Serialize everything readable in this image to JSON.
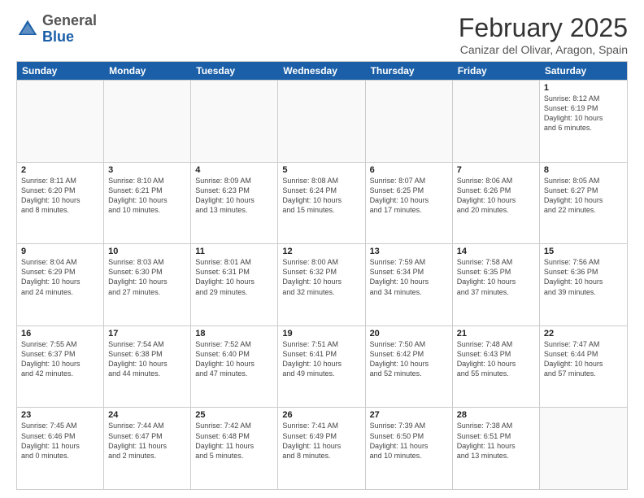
{
  "header": {
    "logo_general": "General",
    "logo_blue": "Blue",
    "month_title": "February 2025",
    "location": "Canizar del Olivar, Aragon, Spain"
  },
  "days_of_week": [
    "Sunday",
    "Monday",
    "Tuesday",
    "Wednesday",
    "Thursday",
    "Friday",
    "Saturday"
  ],
  "weeks": [
    [
      {
        "day": "",
        "empty": true
      },
      {
        "day": "",
        "empty": true
      },
      {
        "day": "",
        "empty": true
      },
      {
        "day": "",
        "empty": true
      },
      {
        "day": "",
        "empty": true
      },
      {
        "day": "",
        "empty": true
      },
      {
        "day": "1",
        "info": "Sunrise: 8:12 AM\nSunset: 6:19 PM\nDaylight: 10 hours\nand 6 minutes."
      }
    ],
    [
      {
        "day": "2",
        "info": "Sunrise: 8:11 AM\nSunset: 6:20 PM\nDaylight: 10 hours\nand 8 minutes."
      },
      {
        "day": "3",
        "info": "Sunrise: 8:10 AM\nSunset: 6:21 PM\nDaylight: 10 hours\nand 10 minutes."
      },
      {
        "day": "4",
        "info": "Sunrise: 8:09 AM\nSunset: 6:23 PM\nDaylight: 10 hours\nand 13 minutes."
      },
      {
        "day": "5",
        "info": "Sunrise: 8:08 AM\nSunset: 6:24 PM\nDaylight: 10 hours\nand 15 minutes."
      },
      {
        "day": "6",
        "info": "Sunrise: 8:07 AM\nSunset: 6:25 PM\nDaylight: 10 hours\nand 17 minutes."
      },
      {
        "day": "7",
        "info": "Sunrise: 8:06 AM\nSunset: 6:26 PM\nDaylight: 10 hours\nand 20 minutes."
      },
      {
        "day": "8",
        "info": "Sunrise: 8:05 AM\nSunset: 6:27 PM\nDaylight: 10 hours\nand 22 minutes."
      }
    ],
    [
      {
        "day": "9",
        "info": "Sunrise: 8:04 AM\nSunset: 6:29 PM\nDaylight: 10 hours\nand 24 minutes."
      },
      {
        "day": "10",
        "info": "Sunrise: 8:03 AM\nSunset: 6:30 PM\nDaylight: 10 hours\nand 27 minutes."
      },
      {
        "day": "11",
        "info": "Sunrise: 8:01 AM\nSunset: 6:31 PM\nDaylight: 10 hours\nand 29 minutes."
      },
      {
        "day": "12",
        "info": "Sunrise: 8:00 AM\nSunset: 6:32 PM\nDaylight: 10 hours\nand 32 minutes."
      },
      {
        "day": "13",
        "info": "Sunrise: 7:59 AM\nSunset: 6:34 PM\nDaylight: 10 hours\nand 34 minutes."
      },
      {
        "day": "14",
        "info": "Sunrise: 7:58 AM\nSunset: 6:35 PM\nDaylight: 10 hours\nand 37 minutes."
      },
      {
        "day": "15",
        "info": "Sunrise: 7:56 AM\nSunset: 6:36 PM\nDaylight: 10 hours\nand 39 minutes."
      }
    ],
    [
      {
        "day": "16",
        "info": "Sunrise: 7:55 AM\nSunset: 6:37 PM\nDaylight: 10 hours\nand 42 minutes."
      },
      {
        "day": "17",
        "info": "Sunrise: 7:54 AM\nSunset: 6:38 PM\nDaylight: 10 hours\nand 44 minutes."
      },
      {
        "day": "18",
        "info": "Sunrise: 7:52 AM\nSunset: 6:40 PM\nDaylight: 10 hours\nand 47 minutes."
      },
      {
        "day": "19",
        "info": "Sunrise: 7:51 AM\nSunset: 6:41 PM\nDaylight: 10 hours\nand 49 minutes."
      },
      {
        "day": "20",
        "info": "Sunrise: 7:50 AM\nSunset: 6:42 PM\nDaylight: 10 hours\nand 52 minutes."
      },
      {
        "day": "21",
        "info": "Sunrise: 7:48 AM\nSunset: 6:43 PM\nDaylight: 10 hours\nand 55 minutes."
      },
      {
        "day": "22",
        "info": "Sunrise: 7:47 AM\nSunset: 6:44 PM\nDaylight: 10 hours\nand 57 minutes."
      }
    ],
    [
      {
        "day": "23",
        "info": "Sunrise: 7:45 AM\nSunset: 6:46 PM\nDaylight: 11 hours\nand 0 minutes."
      },
      {
        "day": "24",
        "info": "Sunrise: 7:44 AM\nSunset: 6:47 PM\nDaylight: 11 hours\nand 2 minutes."
      },
      {
        "day": "25",
        "info": "Sunrise: 7:42 AM\nSunset: 6:48 PM\nDaylight: 11 hours\nand 5 minutes."
      },
      {
        "day": "26",
        "info": "Sunrise: 7:41 AM\nSunset: 6:49 PM\nDaylight: 11 hours\nand 8 minutes."
      },
      {
        "day": "27",
        "info": "Sunrise: 7:39 AM\nSunset: 6:50 PM\nDaylight: 11 hours\nand 10 minutes."
      },
      {
        "day": "28",
        "info": "Sunrise: 7:38 AM\nSunset: 6:51 PM\nDaylight: 11 hours\nand 13 minutes."
      },
      {
        "day": "",
        "empty": true
      }
    ]
  ]
}
